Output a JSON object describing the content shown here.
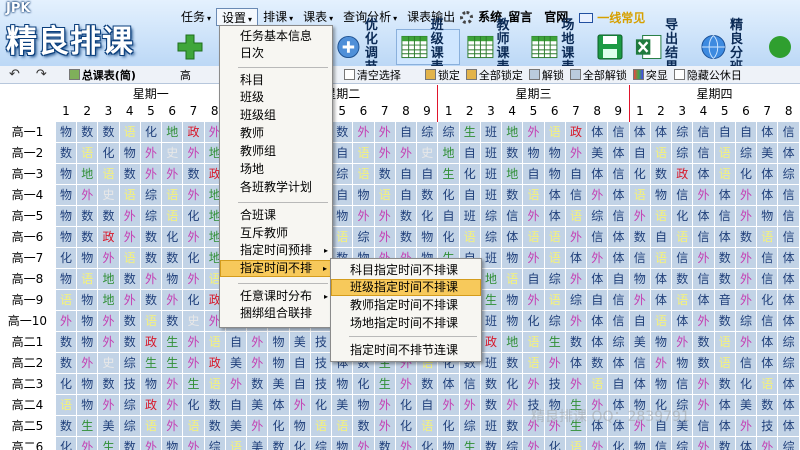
{
  "app": {
    "brand": "JPK",
    "logo_text": "精良排课"
  },
  "menubar": {
    "items": [
      {
        "label": "任务",
        "caret": "▾"
      },
      {
        "label": "设置",
        "caret": "▾"
      },
      {
        "label": "排课",
        "caret": "▾"
      },
      {
        "label": "课表",
        "caret": "▾"
      },
      {
        "label": "查询分析",
        "caret": "▾"
      },
      {
        "label": "课表输出",
        "caret": ""
      }
    ],
    "links": [
      "系统",
      "留言",
      "官网"
    ],
    "faq": "一线常见"
  },
  "toolbar": [
    {
      "line1": "优化",
      "line2": "调节"
    },
    {
      "line1": "班级",
      "line2": "课表"
    },
    {
      "line1": "教师",
      "line2": "课表"
    },
    {
      "line1": "场地",
      "line2": "课表"
    },
    {
      "line1": "导出",
      "line2": "结果"
    },
    {
      "line1": "精良",
      "line2": "分班"
    }
  ],
  "subtoolbar": {
    "undo": "↶",
    "redo": "↷",
    "view_label": "总课表(简)",
    "trailing_char": "高",
    "clear_select": "清空选择",
    "lock": "锁定",
    "lock_all": "全部锁定",
    "unlock": "解锁",
    "unlock_all": "全部解锁",
    "highlight": "突显",
    "hide_public": "隐藏公休日"
  },
  "days": [
    "星期一",
    "星期二",
    "星期三",
    "星期四"
  ],
  "periods": [
    "1",
    "2",
    "3",
    "4",
    "5",
    "6",
    "7",
    "8",
    "9"
  ],
  "day4_periods": [
    "1",
    "2",
    "3",
    "4",
    "5",
    "6",
    "7",
    "8"
  ],
  "rows": [
    "高一1",
    "高一2",
    "高一3",
    "高一4",
    "高一5",
    "高一6",
    "高一7",
    "高一8",
    "高一9",
    "高一10",
    "高二1",
    "高二2",
    "高二3",
    "高二4",
    "高二5",
    "高二6"
  ],
  "grid": [
    [
      "物",
      "数",
      "数",
      "语",
      "化",
      "地",
      "政",
      "外",
      "史",
      "美",
      "信",
      "综",
      "自",
      "数",
      "外",
      "外",
      "自",
      "综",
      "综",
      "生",
      "班",
      "地",
      "外",
      "语",
      "政",
      "体",
      "信",
      "体",
      "体",
      "综",
      "信",
      "自",
      "自",
      "体",
      "信"
    ],
    [
      "数",
      "语",
      "化",
      "物",
      "外",
      "史",
      "外",
      "地",
      "体",
      "信",
      "政",
      "美",
      "综",
      "自",
      "语",
      "外",
      "外",
      "史",
      "地",
      "自",
      "班",
      "数",
      "物",
      "物",
      "外",
      "美",
      "体",
      "自",
      "语",
      "综",
      "信",
      "语",
      "综",
      "美",
      "体"
    ],
    [
      "物",
      "地",
      "语",
      "数",
      "外",
      "外",
      "数",
      "政",
      "体",
      "史",
      "自",
      "美",
      "信",
      "综",
      "语",
      "数",
      "自",
      "自",
      "生",
      "化",
      "班",
      "地",
      "自",
      "物",
      "自",
      "体",
      "信",
      "化",
      "数",
      "政",
      "体",
      "语",
      "化",
      "体",
      "综"
    ],
    [
      "物",
      "外",
      "史",
      "语",
      "综",
      "语",
      "外",
      "地",
      "化",
      "数",
      "自",
      "体",
      "信",
      "自",
      "物",
      "语",
      "自",
      "数",
      "化",
      "自",
      "班",
      "数",
      "语",
      "体",
      "信",
      "外",
      "体",
      "语",
      "物",
      "信",
      "外",
      "体",
      "外",
      "体",
      "信"
    ],
    [
      "物",
      "数",
      "数",
      "外",
      "综",
      "语",
      "化",
      "地",
      "外",
      "史",
      "自",
      "语",
      "自",
      "物",
      "外",
      "外",
      "数",
      "化",
      "自",
      "班",
      "综",
      "信",
      "外",
      "体",
      "语",
      "综",
      "信",
      "外",
      "语",
      "化",
      "体",
      "信",
      "外",
      "物",
      "信"
    ],
    [
      "物",
      "数",
      "政",
      "外",
      "数",
      "化",
      "外",
      "地",
      "史",
      "美",
      "自",
      "信",
      "自",
      "语",
      "综",
      "外",
      "数",
      "物",
      "化",
      "语",
      "综",
      "体",
      "语",
      "语",
      "外",
      "信",
      "体",
      "数",
      "自",
      "语",
      "信",
      "体",
      "数",
      "语",
      "信"
    ],
    [
      "化",
      "物",
      "外",
      "语",
      "数",
      "数",
      "化",
      "地",
      "政",
      "美",
      "综",
      "自",
      "自",
      "数",
      "物",
      "外",
      "外",
      "物",
      "生",
      "自",
      "班",
      "物",
      "外",
      "语",
      "体",
      "外",
      "体",
      "信",
      "语",
      "信",
      "外",
      "数",
      "外",
      "信",
      "体"
    ],
    [
      "物",
      "语",
      "地",
      "数",
      "外",
      "物",
      "外",
      "语",
      "化",
      "史",
      "美",
      "体",
      "综",
      "外",
      "数",
      "外",
      "数",
      "语",
      "物",
      "化",
      "地",
      "语",
      "自",
      "综",
      "外",
      "体",
      "自",
      "物",
      "体",
      "数",
      "信",
      "数",
      "外",
      "信",
      "体"
    ],
    [
      "语",
      "物",
      "地",
      "外",
      "数",
      "外",
      "化",
      "政",
      "物",
      "语",
      "数",
      "外",
      "自",
      "外",
      "信",
      "史",
      "外",
      "班",
      "自",
      "地",
      "生",
      "物",
      "外",
      "语",
      "综",
      "自",
      "信",
      "外",
      "体",
      "语",
      "体",
      "音",
      "外",
      "化",
      "体"
    ],
    [
      "外",
      "物",
      "外",
      "数",
      "语",
      "数",
      "史",
      "外",
      "外",
      "化",
      "自",
      "信",
      "自",
      "体",
      "自",
      "外",
      "外",
      "自",
      "语",
      "数",
      "班",
      "物",
      "化",
      "综",
      "外",
      "体",
      "信",
      "自",
      "语",
      "体",
      "外",
      "数",
      "综",
      "信",
      "体"
    ],
    [
      "数",
      "物",
      "外",
      "数",
      "政",
      "生",
      "外",
      "语",
      "自",
      "外",
      "物",
      "美",
      "技",
      "自",
      "外",
      "政",
      "化",
      "史",
      "物",
      "外",
      "政",
      "地",
      "语",
      "生",
      "数",
      "体",
      "综",
      "美",
      "物",
      "外",
      "数",
      "语",
      "外",
      "体",
      "综"
    ],
    [
      "数",
      "外",
      "史",
      "综",
      "生",
      "生",
      "外",
      "政",
      "美",
      "外",
      "物",
      "自",
      "技",
      "体",
      "数",
      "生",
      "外",
      "语",
      "化",
      "数",
      "班",
      "数",
      "语",
      "外",
      "体",
      "数",
      "体",
      "信",
      "外",
      "物",
      "数",
      "语",
      "信",
      "体",
      "综"
    ],
    [
      "化",
      "物",
      "数",
      "技",
      "物",
      "外",
      "生",
      "语",
      "外",
      "数",
      "美",
      "自",
      "技",
      "物",
      "化",
      "生",
      "外",
      "数",
      "体",
      "信",
      "数",
      "化",
      "外",
      "技",
      "外",
      "语",
      "自",
      "体",
      "物",
      "信",
      "外",
      "数",
      "化",
      "语",
      "体"
    ],
    [
      "语",
      "物",
      "外",
      "综",
      "政",
      "外",
      "化",
      "数",
      "自",
      "美",
      "体",
      "外",
      "化",
      "美",
      "物",
      "外",
      "化",
      "自",
      "外",
      "外",
      "数",
      "外",
      "技",
      "物",
      "生",
      "外",
      "体",
      "物",
      "化",
      "综",
      "外",
      "体",
      "美",
      "数",
      "体"
    ],
    [
      "数",
      "生",
      "美",
      "综",
      "语",
      "外",
      "语",
      "数",
      "美",
      "外",
      "化",
      "物",
      "语",
      "语",
      "数",
      "外",
      "化",
      "语",
      "化",
      "综",
      "班",
      "数",
      "外",
      "外",
      "生",
      "体",
      "体",
      "外",
      "自",
      "美",
      "信",
      "体",
      "外",
      "技",
      "体"
    ],
    [
      "化",
      "外",
      "生",
      "数",
      "外",
      "物",
      "外",
      "综",
      "语",
      "美",
      "数",
      "化",
      "综",
      "物",
      "外",
      "数",
      "外",
      "化",
      "物",
      "生",
      "数",
      "综",
      "外",
      "化",
      "语",
      "外",
      "化",
      "物",
      "信",
      "综",
      "外",
      "数",
      "体",
      "外",
      "综"
    ]
  ],
  "subject_colors": {
    "物": "#1f3f7a",
    "数": "#1f3f7a",
    "化": "#1f3f7a",
    "综": "#1f3f7a",
    "自": "#1f3f7a",
    "班": "#1f3f7a",
    "信": "#1f3f7a",
    "体": "#1f3f7a",
    "技": "#1f3f7a",
    "音": "#1f3f7a",
    "语": "#f5f27a",
    "外": "#c43fb3",
    "史": "#e8e8e8",
    "地": "#2f8f35",
    "生": "#2f8f35",
    "政": "#d8182a",
    "美": "#1f3f7a"
  },
  "dropdown": {
    "items": [
      "任务基本信息",
      "日次",
      "科目",
      "班级",
      "班级组",
      "教师",
      "教师组",
      "场地",
      "各班教学计划",
      "合班课",
      "互斥教师",
      "指定时间预排",
      "指定时间不排",
      "任意课时分布",
      "捆绑组合联排"
    ],
    "arrow": "▸"
  },
  "submenu": {
    "items": [
      "科目指定时间不排课",
      "班级指定时间不排课",
      "教师指定时间不排课",
      "场地指定时间不排课",
      "指定时间不排节连课"
    ]
  },
  "watermark": "精良排课 QQ：2839791"
}
